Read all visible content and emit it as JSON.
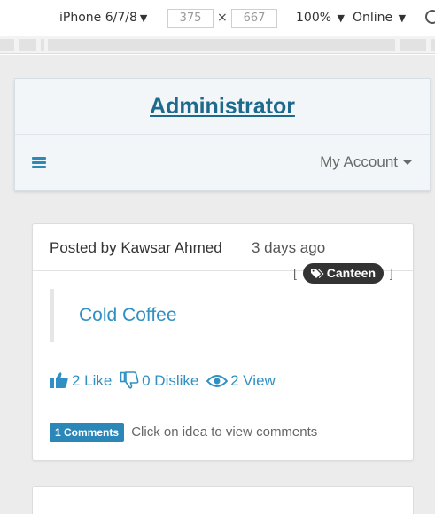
{
  "devtools": {
    "device": "iPhone 6/7/8",
    "width": "375",
    "height": "667",
    "times": "×",
    "zoom": "100%",
    "network": "Online"
  },
  "header": {
    "title": "Administrator",
    "account_label": "My Account"
  },
  "post": {
    "posted_by": "Posted by Kawsar Ahmed",
    "time": "3 days ago",
    "tag_open": "[",
    "tag": "Canteen",
    "tag_close": "]",
    "idea_title": "Cold Coffee",
    "like_label": "2 Like",
    "dislike_label": "0 Dislike",
    "view_label": "2 View",
    "comments_badge": "1 Comments",
    "comments_hint": "Click on idea to view comments"
  },
  "colors": {
    "accent": "#3190c3",
    "title": "#1e6a8d",
    "tag_bg": "#333333",
    "badge_bg": "#2b87b8"
  }
}
